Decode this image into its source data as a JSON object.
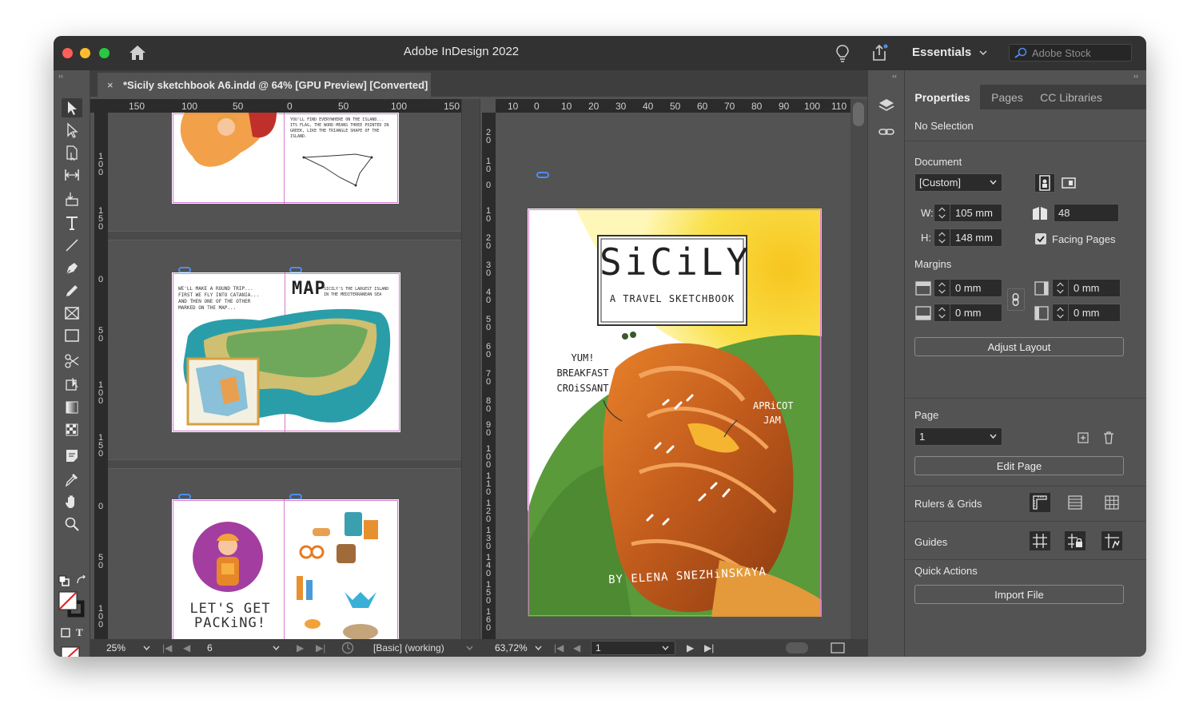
{
  "window": {
    "title": "Adobe InDesign 2022",
    "workspace": "Essentials",
    "stock_placeholder": "Adobe Stock"
  },
  "document_tab": {
    "close": "×",
    "name": "*Sicily sketchbook A6.indd @ 64% [GPU Preview] [Converted]"
  },
  "left_ruler_ticks": [
    "150",
    "100",
    "50",
    "0",
    "50",
    "100",
    "150"
  ],
  "left_vruler_ticks": [
    "100",
    "150",
    "0",
    "50",
    "100",
    "150",
    "0",
    "50",
    "100"
  ],
  "right_ruler_ticks": [
    "10",
    "0",
    "10",
    "20",
    "30",
    "40",
    "50",
    "60",
    "70",
    "80",
    "90",
    "100",
    "110"
  ],
  "right_vruler_ticks": [
    "20",
    "10",
    "0",
    "10",
    "20",
    "30",
    "40",
    "50",
    "60",
    "70",
    "80",
    "90",
    "100",
    "110",
    "120",
    "130",
    "140",
    "150",
    "160"
  ],
  "cover": {
    "title": "SiCiLY",
    "subtitle": "A TRAVEL SKETCHBOOK",
    "note1": "YUM! BREAKFAST CROiSSANT",
    "note2": "APRiCOT JAM",
    "author": "BY ELENA SNEZHiNSKAYA"
  },
  "thumb_pages": {
    "map_title": "MAP",
    "packing_title": "LET'S GET PACKiNG!"
  },
  "status_left": {
    "zoom": "25%",
    "page": "6",
    "style": "[Basic] (working)"
  },
  "status_right": {
    "zoom": "63,72%",
    "page": "1"
  },
  "panel": {
    "tabs": [
      "Properties",
      "Pages",
      "CC Libraries"
    ],
    "selection": "No Selection",
    "document_label": "Document",
    "preset": "[Custom]",
    "width_label": "W:",
    "width": "105 mm",
    "height_label": "H:",
    "height": "148 mm",
    "pages_count": "48",
    "facing_pages": "Facing Pages",
    "margins_label": "Margins",
    "margin_top": "0 mm",
    "margin_bottom": "0 mm",
    "margin_inside": "0 mm",
    "margin_outside": "0 mm",
    "adjust_layout": "Adjust Layout",
    "page_label": "Page",
    "page_value": "1",
    "edit_page": "Edit Page",
    "rulers_grids": "Rulers & Grids",
    "guides": "Guides",
    "quick_actions": "Quick Actions",
    "import_file": "Import File"
  },
  "colors": {
    "ui_dark": "#323232",
    "ui_mid": "#535353",
    "margin_guide": "#d67ad0",
    "link_badge": "#4e8df0"
  }
}
